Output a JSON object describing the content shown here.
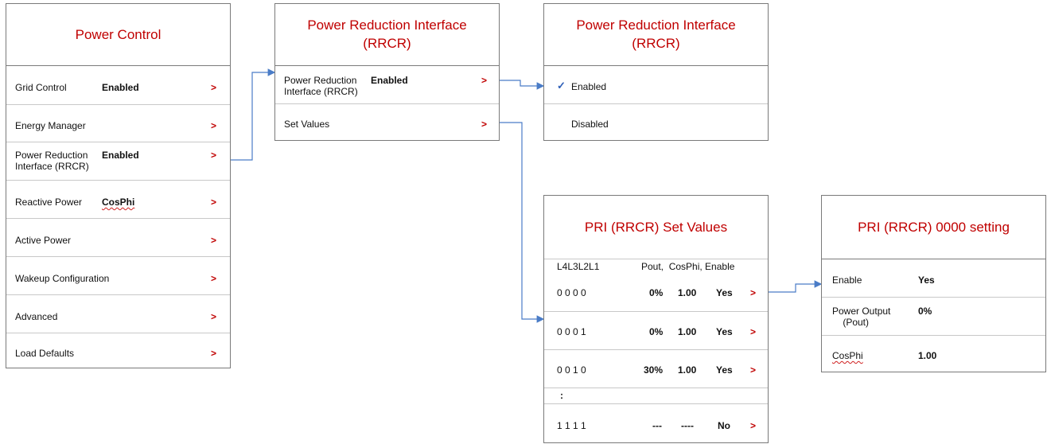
{
  "power_control": {
    "title": "Power Control",
    "rows": [
      {
        "label": "Grid Control",
        "value": "Enabled",
        "chevron": ">"
      },
      {
        "label": "Energy Manager",
        "value": "",
        "chevron": ">"
      },
      {
        "label": "Power Reduction\nInterface (RRCR)",
        "value": "Enabled",
        "chevron": ">"
      },
      {
        "label": "Reactive Power",
        "value": "CosPhi",
        "chevron": ">"
      },
      {
        "label": "Active Power",
        "value": "",
        "chevron": ">"
      },
      {
        "label": "Wakeup Configuration",
        "value": "",
        "chevron": ">"
      },
      {
        "label": "Advanced",
        "value": "",
        "chevron": ">"
      },
      {
        "label": "Load Defaults",
        "value": "",
        "chevron": ">"
      }
    ]
  },
  "rrcr_menu": {
    "title": "Power Reduction Interface\n(RRCR)",
    "rows": [
      {
        "label": "Power Reduction\nInterface (RRCR)",
        "value": "Enabled",
        "chevron": ">"
      },
      {
        "label": "Set Values",
        "value": "",
        "chevron": ">"
      }
    ]
  },
  "rrcr_select": {
    "title": "Power Reduction Interface\n(RRCR)",
    "check": "✓",
    "options": [
      "Enabled",
      "Disabled"
    ]
  },
  "set_values": {
    "title": "PRI (RRCR) Set Values",
    "header_left": "L4L3L2L1",
    "header_right": "Pout,  CosPhi, Enable",
    "rows": [
      {
        "bits": "0 0 0 0",
        "pout": "0%",
        "cosphi": "1.00",
        "enable": "Yes",
        "chevron": ">"
      },
      {
        "bits": "0 0 0 1",
        "pout": "0%",
        "cosphi": "1.00",
        "enable": "Yes",
        "chevron": ">"
      },
      {
        "bits": "0 0 1 0",
        "pout": "30%",
        "cosphi": "1.00",
        "enable": "Yes",
        "chevron": ">"
      },
      {
        "bits": ":",
        "pout": "",
        "cosphi": "",
        "enable": "",
        "chevron": ""
      },
      {
        "bits": "1 1 1 1",
        "pout": "---",
        "cosphi": "----",
        "enable": "No",
        "chevron": ">"
      }
    ]
  },
  "setting_0000": {
    "title": "PRI (RRCR) 0000 setting",
    "rows": [
      {
        "label": "Enable",
        "value": "Yes"
      },
      {
        "label": "Power Output\n    (Pout)",
        "value": "0%"
      },
      {
        "label": "CosPhi",
        "value": "1.00"
      }
    ]
  }
}
